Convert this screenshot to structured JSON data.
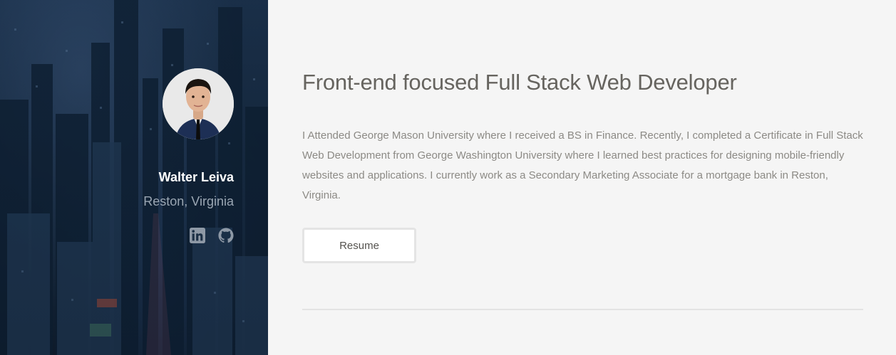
{
  "sidebar": {
    "profile": {
      "name": "Walter Leiva",
      "location": "Reston, Virginia",
      "avatar_icon": "avatar"
    },
    "social_links": [
      {
        "icon": "linkedin-icon",
        "label": "LinkedIn"
      },
      {
        "icon": "github-icon",
        "label": "GitHub"
      }
    ],
    "colors": {
      "name_text": "#ffffff",
      "location_text": "#9aa6b3",
      "social_icon": "#8e99a6"
    }
  },
  "main": {
    "headline": "Front-end focused Full Stack Web Developer",
    "bio": "I Attended George Mason University where I received a BS in Finance. Recently, I completed a Certificate in Full Stack Web Development from George Washington University where I learned best practices for designing mobile-friendly websites and applications. I currently work as a Secondary Marketing Associate for a mortgage bank in Reston, Virginia.",
    "resume_button_label": "Resume",
    "colors": {
      "background": "#f5f5f5",
      "headline_text": "#66645f",
      "body_text": "#8c8a85",
      "divider": "#e3e3e3"
    }
  }
}
